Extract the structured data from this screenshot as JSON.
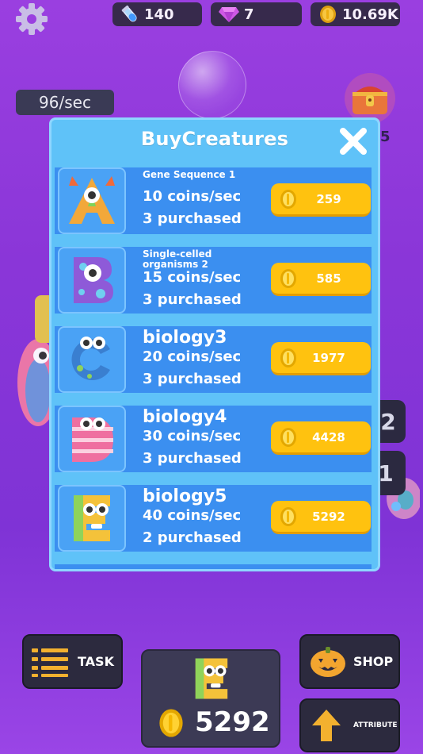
{
  "topbar": {
    "potion": "140",
    "gems": "7",
    "coins": "10.69K"
  },
  "rate_badge": "96/sec",
  "chest_badge": "5",
  "side_tiles": [
    "2",
    "1"
  ],
  "modal": {
    "title": "BuyCreatures",
    "items": [
      {
        "name": "Gene Sequence 1",
        "rate": "10 coins/sec",
        "purchased": "3 purchased",
        "price": "259",
        "letter": "A",
        "color": "#f2a83a"
      },
      {
        "name": "Single-celled organisms 2",
        "rate": "15 coins/sec",
        "purchased": "3 purchased",
        "price": "585",
        "letter": "B",
        "color": "#8e5ad8"
      },
      {
        "name": "biology3",
        "rate": "20 coins/sec",
        "purchased": "3 purchased",
        "price": "1977",
        "letter": "C",
        "color": "#3a7fd0"
      },
      {
        "name": "biology4",
        "rate": "30 coins/sec",
        "purchased": "3 purchased",
        "price": "4428",
        "letter": "D",
        "color": "#ef6fa0"
      },
      {
        "name": "biology5",
        "rate": "40 coins/sec",
        "purchased": "2 purchased",
        "price": "5292",
        "letter": "E",
        "color": "#f4c23a"
      }
    ]
  },
  "bottom": {
    "task_label": "TASK",
    "shop_label": "SHOP",
    "attribute_label": "ATTRIBUTE",
    "current_cost": "5292",
    "current_letter": "E"
  },
  "colors": {
    "modal_bg": "#5fc2f8",
    "row_bg": "#3b8ff0",
    "buy_button": "#ffc20f",
    "background_purple": "#8a36d8"
  },
  "icons": [
    "gear-icon",
    "potion-icon",
    "gem-icon",
    "coin-icon",
    "chest-icon",
    "close-icon",
    "task-list-icon",
    "pumpkin-icon",
    "arrow-up-icon"
  ]
}
